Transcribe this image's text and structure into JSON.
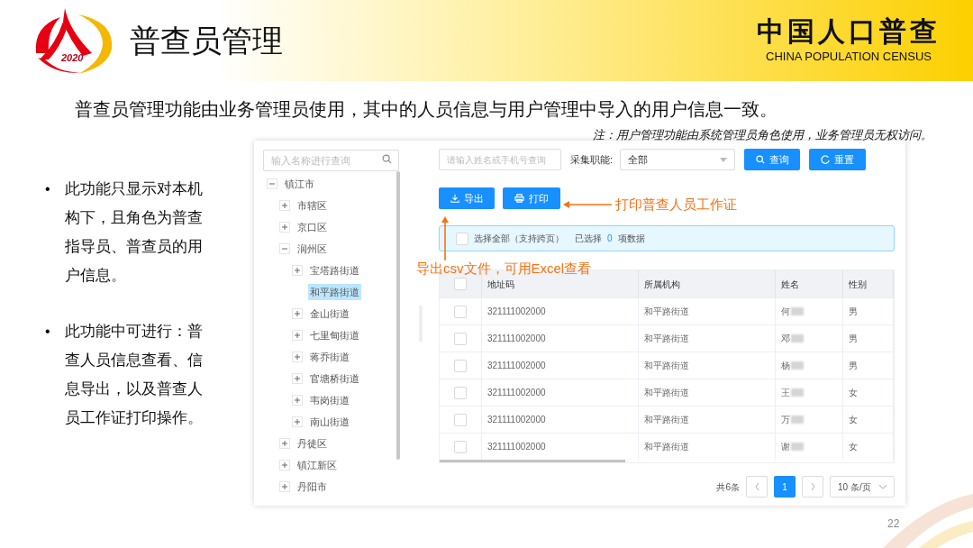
{
  "header": {
    "logo_text": "2020",
    "title": "普查员管理",
    "brand_cn": "中国人口普查",
    "brand_en": "CHINA POPULATION CENSUS"
  },
  "subtitle": "普查员管理功能由业务管理员使用，其中的人员信息与用户管理中导入的用户信息一致。",
  "note": "注：用户管理功能由系统管理员角色使用，业务管理员无权访问。",
  "bullets": [
    {
      "marker": "•",
      "text": "此功能只显示对本机构下，且角色为普查指导员、普查员的用户信息。"
    },
    {
      "marker": "•",
      "text": "此功能中可进行：普查人员信息查看、信息导出，以及普查人员工作证打印操作。"
    }
  ],
  "tree": {
    "search": {
      "placeholder": "输入名称进行查询"
    },
    "items": [
      {
        "label": "镇江市",
        "kind": "branch",
        "expanded": true,
        "selected": false,
        "children": [
          {
            "label": "市辖区",
            "kind": "branch",
            "expanded": false,
            "selected": false
          },
          {
            "label": "京口区",
            "kind": "branch",
            "expanded": false,
            "selected": false
          },
          {
            "label": "润州区",
            "kind": "branch",
            "expanded": true,
            "selected": false,
            "children": [
              {
                "label": "宝塔路街道",
                "kind": "branch",
                "expanded": false,
                "selected": false
              },
              {
                "label": "和平路街道",
                "kind": "leaf",
                "selected": true
              },
              {
                "label": "金山街道",
                "kind": "branch",
                "expanded": false,
                "selected": false
              },
              {
                "label": "七里甸街道",
                "kind": "branch",
                "expanded": false,
                "selected": false
              },
              {
                "label": "蒋乔街道",
                "kind": "branch",
                "expanded": false,
                "selected": false
              },
              {
                "label": "官塘桥街道",
                "kind": "branch",
                "expanded": false,
                "selected": false
              },
              {
                "label": "韦岗街道",
                "kind": "branch",
                "expanded": false,
                "selected": false
              },
              {
                "label": "南山街道",
                "kind": "branch",
                "expanded": false,
                "selected": false
              }
            ]
          },
          {
            "label": "丹徒区",
            "kind": "branch",
            "expanded": false,
            "selected": false
          },
          {
            "label": "镇江新区",
            "kind": "branch",
            "expanded": false,
            "selected": false
          },
          {
            "label": "丹阳市",
            "kind": "branch",
            "expanded": false,
            "selected": false
          }
        ]
      }
    ]
  },
  "filters": {
    "search": {
      "placeholder": "请输入姓名或手机号查询"
    },
    "role_label": "采集职能:",
    "role_value": "全部",
    "query_button": "查询",
    "reset_button": "重置"
  },
  "actions": {
    "export_button": "导出",
    "print_button": "打印"
  },
  "selection_bar": {
    "checked": false,
    "select_all": "选择全部（支持跨页）",
    "selected_prefix": "已选择",
    "selected_count": "0",
    "selected_suffix": "项数据"
  },
  "table": {
    "header_checked": false,
    "columns": [
      "地址码",
      "所属机构",
      "姓名",
      "性别"
    ],
    "rows": [
      {
        "checked": false,
        "cells": [
          "321111002000",
          "和平路街道",
          "何",
          "男"
        ]
      },
      {
        "checked": false,
        "cells": [
          "321111002000",
          "和平路街道",
          "邓",
          "男"
        ]
      },
      {
        "checked": false,
        "cells": [
          "321111002000",
          "和平路街道",
          "杨",
          "男"
        ]
      },
      {
        "checked": false,
        "cells": [
          "321111002000",
          "和平路街道",
          "王",
          "女"
        ]
      },
      {
        "checked": false,
        "cells": [
          "321111002000",
          "和平路街道",
          "万",
          "女"
        ]
      },
      {
        "checked": false,
        "cells": [
          "321111002000",
          "和平路街道",
          "谢",
          "女"
        ]
      }
    ]
  },
  "pagination": {
    "total": "共6条",
    "pages": [
      {
        "label": "1",
        "selected": true
      }
    ],
    "page_size": "10 条/页"
  },
  "annotations": {
    "print": "打印普查人员工作证",
    "export": "导出csv文件，可用Excel查看"
  },
  "page_number": "22"
}
